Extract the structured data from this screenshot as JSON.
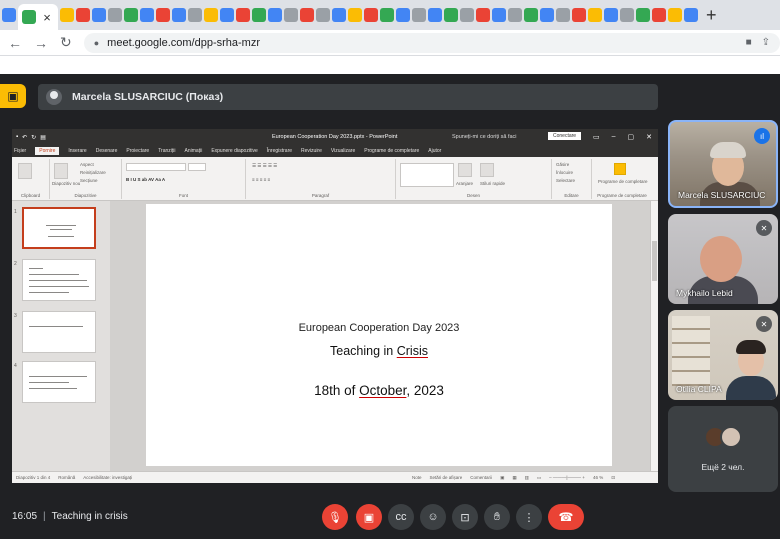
{
  "browser": {
    "url": "meet.google.com/dpp-srha-mzr",
    "tab_close": "×",
    "new_tab": "+",
    "tab_favicons": [
      "#4285f4",
      "#34a853",
      "#fbbc04",
      "#ea4335",
      "#4285f4",
      "#9aa0a6",
      "#34a853",
      "#4285f4",
      "#ea4335",
      "#4285f4",
      "#9aa0a6",
      "#fbbc04",
      "#4285f4",
      "#ea4335",
      "#34a853",
      "#4285f4",
      "#9aa0a6",
      "#ea4335",
      "#9aa0a6",
      "#4285f4",
      "#fbbc04",
      "#ea4335",
      "#34a853",
      "#4285f4",
      "#9aa0a6",
      "#4285f4",
      "#34a853",
      "#9aa0a6",
      "#ea4335",
      "#4285f4",
      "#9aa0a6",
      "#34a853",
      "#4285f4",
      "#9aa0a6",
      "#ea4335",
      "#fbbc04",
      "#4285f4",
      "#9aa0a6",
      "#34a853",
      "#ea4335",
      "#fbbc04",
      "#4285f4"
    ]
  },
  "meet": {
    "presenter_label": "Marcela SLUSARCIUC (Показ)",
    "meeting_time": "16:05",
    "meeting_title": "Teaching in crisis",
    "participants": [
      {
        "name": "Marcela SLUSARCIUC"
      },
      {
        "name": "Mykhailo Lebid"
      },
      {
        "name": "Otilia CLIPA"
      }
    ],
    "more_label": "Ещё 2 чел."
  },
  "ppt": {
    "window_title": "European Cooperation Day 2023.pptx - PowerPoint",
    "sign_in": "Conectare",
    "search": "Spuneți-mi ce doriți să faci",
    "menu": [
      "Fișier",
      "Pornire",
      "Inserare",
      "Desenare",
      "Proiectare",
      "Tranziții",
      "Animații",
      "Expunere diapozitive",
      "Înregistrare",
      "Revizuire",
      "Vizualizare",
      "Programe de completare",
      "Ajutor"
    ],
    "ribbon_groups": [
      "Clipboard",
      "Diapozitive",
      "Font",
      "Paragraf",
      "Desen",
      "Editare",
      "Programe de completare"
    ],
    "ribbon_buttons": {
      "layout": "Aspect",
      "reset": "Reinițializare",
      "section": "Secțiune",
      "new_slide": "Diapozitiv nou",
      "arrange": "Aranjare",
      "styles": "Stiluri rapide",
      "find": "Găsire",
      "replace": "Înlocuire",
      "select": "Selectare",
      "addins": "Programe de completare"
    },
    "slide": {
      "line1": "European Cooperation Day 2023",
      "line2_a": "Teaching in ",
      "line2_b": "Crisis",
      "line3_a": "18th of ",
      "line3_b": "October",
      "line3_c": ", 2023"
    },
    "thumb_numbers": [
      "1",
      "2",
      "3",
      "4"
    ],
    "status_left": "Diapozitiv 1 din 4",
    "status_lang": "Română",
    "status_access": "Accesibilitate: investigați",
    "status_notes": "Note",
    "status_display": "Setări de afișare",
    "status_comments": "Comentarii",
    "zoom": "46 %"
  },
  "colors": {
    "meet_bg": "#202124",
    "control_bg": "#3c4043",
    "red": "#ea4335",
    "active_border": "#8ab4f8",
    "ppt_accent": "#c43e1c"
  }
}
